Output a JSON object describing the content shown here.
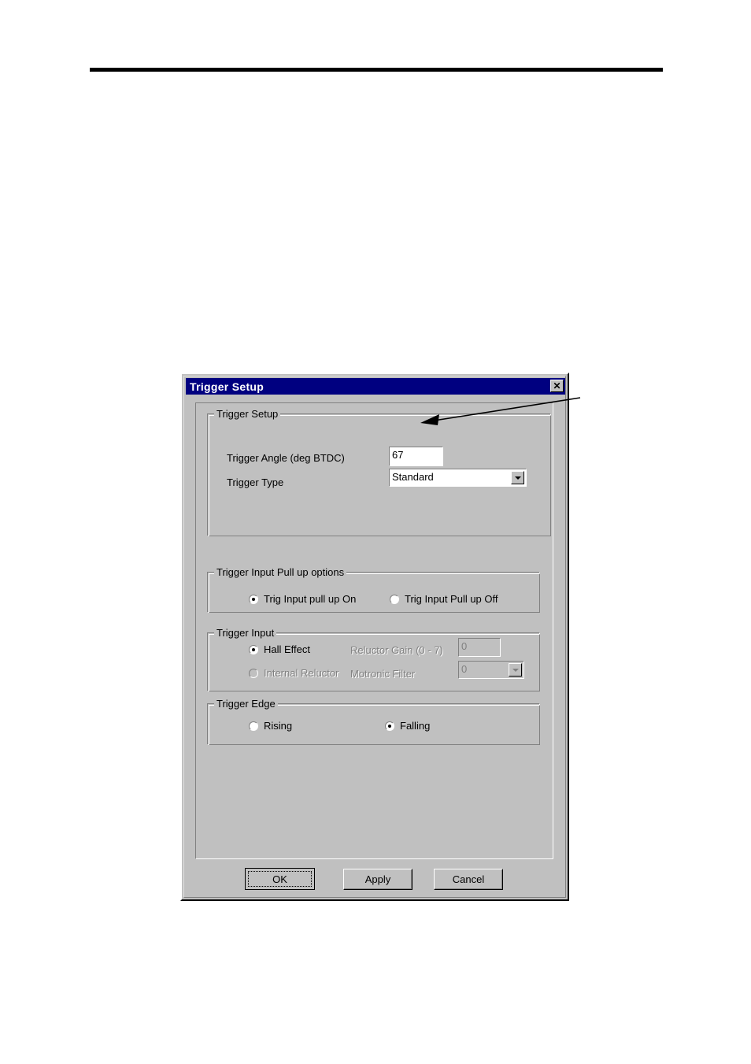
{
  "page": {
    "header_rule": "horizontal-rule"
  },
  "dialog": {
    "title": "Trigger Setup",
    "close_label": "✕",
    "colors": {
      "titlebar": "#000080",
      "face": "#c0c0c0",
      "text": "#000000",
      "disabled_text": "#808080",
      "field": "#ffffff"
    },
    "groups": {
      "trigger_setup": {
        "legend": "Trigger Setup",
        "angle_label": "Trigger Angle (deg BTDC)",
        "angle_value": "67",
        "type_label": "Trigger Type",
        "type_value": "Standard"
      },
      "pullup": {
        "legend": "Trigger Input Pull up options",
        "option_on": "Trig Input pull up On",
        "option_off": "Trig Input Pull up Off",
        "selected": "on"
      },
      "trigger_input": {
        "legend": "Trigger Input",
        "option_hall": "Hall Effect",
        "option_reluctor": "Internal Reluctor",
        "selected": "hall",
        "reluctor_gain_label": "Reluctor Gain (0 - 7)",
        "reluctor_gain_value": "0",
        "motronic_filter_label": "Motronic Filter",
        "motronic_filter_value": "0"
      },
      "trigger_edge": {
        "legend": "Trigger Edge",
        "option_rising": "Rising",
        "option_falling": "Falling",
        "selected": "falling"
      }
    },
    "buttons": {
      "ok": "OK",
      "apply": "Apply",
      "cancel": "Cancel"
    }
  },
  "annotation": {
    "arrow": "callout-arrow-to-trigger-angle-field"
  }
}
